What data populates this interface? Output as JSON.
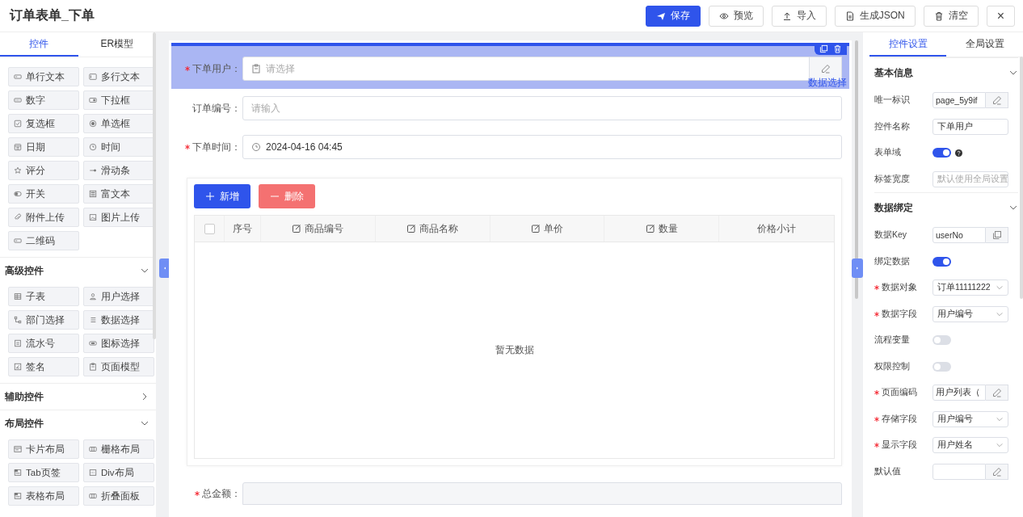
{
  "title": "订单表单_下单",
  "toolbar": [
    {
      "label": "保存",
      "kind": "primary"
    },
    {
      "label": "预览",
      "kind": "default"
    },
    {
      "label": "导入",
      "kind": "default"
    },
    {
      "label": "生成JSON",
      "kind": "default"
    },
    {
      "label": "清空",
      "kind": "default"
    },
    {
      "label": "×",
      "kind": "close"
    }
  ],
  "left_tabs": [
    {
      "label": "控件",
      "selected": true
    },
    {
      "label": "ER模型",
      "selected": false
    }
  ],
  "basic_controls": [
    "单行文本",
    "多行文本",
    "数字",
    "下拉框",
    "复选框",
    "单选框",
    "日期",
    "时间",
    "评分",
    "滑动条",
    "开关",
    "富文本",
    "附件上传",
    "图片上传",
    "二维码"
  ],
  "control_groups": [
    {
      "title": "高级控件",
      "expanded": true,
      "items": [
        "子表",
        "用户选择",
        "部门选择",
        "数据选择",
        "流水号",
        "图标选择",
        "签名",
        "页面模型"
      ]
    },
    {
      "title": "辅助控件",
      "expanded": false
    },
    {
      "title": "布局控件",
      "expanded": true,
      "items": [
        "卡片布局",
        "栅格布局",
        "Tab页签",
        "Div布局",
        "表格布局",
        "折叠面板"
      ]
    }
  ],
  "form_fields": [
    {
      "label": "下单用户：",
      "required": true,
      "kind": "select",
      "placeholder": "请选择",
      "selected": true,
      "link": "数据选择"
    },
    {
      "label": "订单编号：",
      "required": false,
      "kind": "input",
      "placeholder": "请输入",
      "selected": false
    },
    {
      "label": "下单时间：",
      "required": true,
      "kind": "date",
      "value": "2024-04-16 04:45",
      "selected": false
    }
  ],
  "subtable": {
    "buttons": [
      {
        "label": "新增",
        "kind": "add"
      },
      {
        "label": "删除",
        "kind": "delete"
      }
    ],
    "select_all": {
      "checked": false
    },
    "columns": [
      {
        "label": "序号",
        "editable": false
      },
      {
        "label": "商品编号",
        "editable": true
      },
      {
        "label": "商品名称",
        "editable": true
      },
      {
        "label": "单价",
        "editable": true
      },
      {
        "label": "数量",
        "editable": true
      },
      {
        "label": "价格小计",
        "editable": false
      }
    ],
    "empty_text": "暂无数据"
  },
  "total_field": {
    "label": "总金额：",
    "required": true
  },
  "right_tabs": [
    {
      "label": "控件设置",
      "selected": true
    },
    {
      "label": "全局设置",
      "selected": false
    }
  ],
  "settings": [
    {
      "title": "基本信息",
      "expanded": true,
      "rows": [
        {
          "label": "唯一标识",
          "required": false,
          "kind": "edit",
          "value": "page_5y9if"
        },
        {
          "label": "控件名称",
          "required": false,
          "kind": "input",
          "value": "下单用户"
        },
        {
          "label": "表单域",
          "required": false,
          "kind": "switch",
          "on": true,
          "help": true
        },
        {
          "label": "标签宽度",
          "required": false,
          "kind": "input",
          "placeholder": "默认使用全局设置"
        }
      ]
    },
    {
      "title": "数据绑定",
      "expanded": true,
      "rows": [
        {
          "label": "数据Key",
          "required": false,
          "kind": "copy",
          "value": "userNo"
        },
        {
          "label": "绑定数据",
          "required": false,
          "kind": "switch",
          "on": true,
          "help": false
        },
        {
          "label": "数据对象",
          "required": true,
          "kind": "select",
          "value": "订单11111222"
        },
        {
          "label": "数据字段",
          "required": true,
          "kind": "select",
          "value": "用户编号"
        },
        {
          "label": "流程变量",
          "required": false,
          "kind": "switch",
          "on": false,
          "help": false
        },
        {
          "label": "权限控制",
          "required": false,
          "kind": "switch",
          "on": false,
          "help": false
        },
        {
          "label": "页面编码",
          "required": true,
          "kind": "edit",
          "value": "用户列表（"
        },
        {
          "label": "存储字段",
          "required": true,
          "kind": "select",
          "value": "用户编号"
        },
        {
          "label": "显示字段",
          "required": true,
          "kind": "select",
          "value": "用户姓名"
        },
        {
          "label": "默认值",
          "required": false,
          "kind": "edit"
        }
      ]
    }
  ]
}
